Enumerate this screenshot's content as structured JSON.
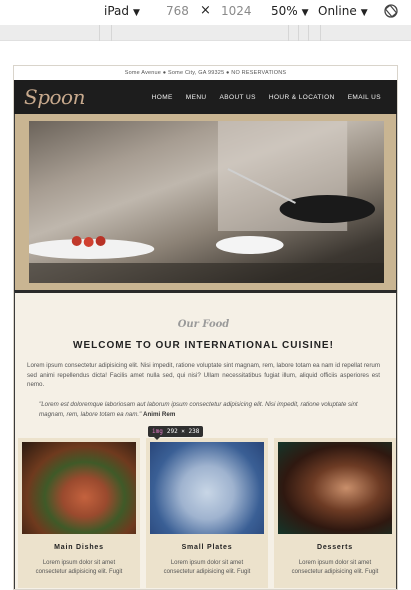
{
  "devtools": {
    "device": "iPad",
    "width": "768",
    "height": "1024",
    "times": "×",
    "zoom": "50%",
    "network": "Online"
  },
  "site": {
    "topline": "Some Avenue ● Some City, GA 99325 ● NO RESERVATIONS",
    "logo": "Spoon",
    "menu": [
      "HOME",
      "MENU",
      "ABOUT US",
      "HOUR & LOCATION",
      "EMAIL US"
    ],
    "subtitle": "Our Food",
    "heading": "WELCOME TO OUR INTERNATIONAL CUISINE!",
    "paragraph": "Lorem ipsum consectetur adipisicing elit. Nisi impedit, ratione voluptate sint magnam, rem, labore totam ea nam id repellat rerum sed animi repellendus dicta! Facilis amet nulla sed, qui nisi? Ullam necessitatibus fugiat illum, aliquid officiis asperiores est nemo.",
    "quote": "\"Lorem est doloremque laboriosam aut laborum ipsum consectetur adipisicing elit. Nisi impedit, ratione voluptate sint magnam, rem, labore totam ea nam.\"",
    "quote_author": "Animi Rem",
    "cards": [
      {
        "title": "Main Dishes",
        "text_line1": "Lorem ipsum dolor sit amet",
        "text_line2": "consectetur adipisicing elit. Fugit"
      },
      {
        "title": "Small Plates",
        "text_line1": "Lorem ipsum dolor sit amet",
        "text_line2": "consectetur adipisicing elit. Fugit"
      },
      {
        "title": "Desserts",
        "text_line1": "Lorem ipsum dolor sit amet",
        "text_line2": "consectetur adipisicing elit. Fugit"
      }
    ]
  },
  "inspector": {
    "tag": "img",
    "size": "292 × 238"
  }
}
